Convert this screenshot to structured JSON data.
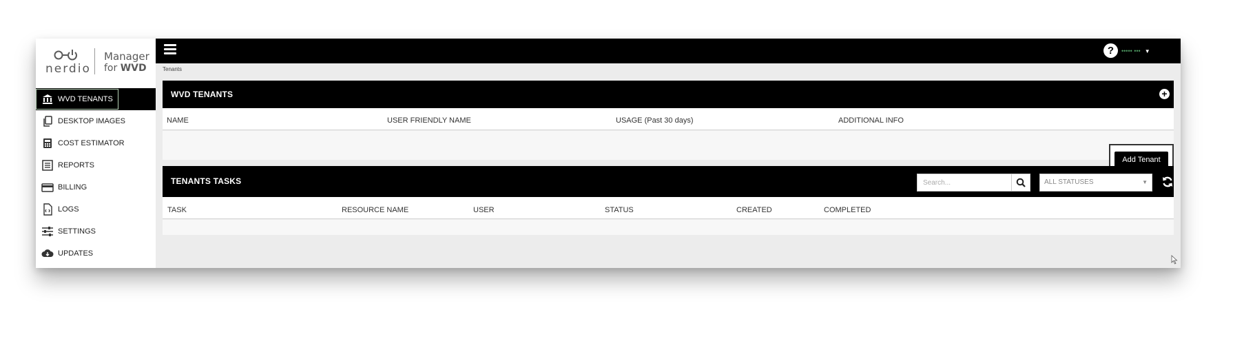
{
  "brand": {
    "wordmark": "nerdio",
    "product_line1": "Manager",
    "product_line2_prefix": "for ",
    "product_line2_bold": "WVD"
  },
  "sidebar": {
    "items": [
      {
        "label": "WVD TENANTS",
        "icon": "bank-icon",
        "active": true
      },
      {
        "label": "DESKTOP IMAGES",
        "icon": "copy-icon",
        "active": false
      },
      {
        "label": "COST ESTIMATOR",
        "icon": "calculator-icon",
        "active": false
      },
      {
        "label": "REPORTS",
        "icon": "list-icon",
        "active": false
      },
      {
        "label": "BILLING",
        "icon": "credit-card-icon",
        "active": false
      },
      {
        "label": "LOGS",
        "icon": "code-file-icon",
        "active": false
      },
      {
        "label": "SETTINGS",
        "icon": "sliders-icon",
        "active": false
      },
      {
        "label": "UPDATES",
        "icon": "cloud-download-icon",
        "active": false
      }
    ]
  },
  "topbar": {
    "help_label": "?",
    "user_name": "••••• •••"
  },
  "breadcrumb": "Tenants",
  "tenants_panel": {
    "title": "WVD TENANTS",
    "columns": [
      "NAME",
      "USER FRIENDLY NAME",
      "USAGE (Past 30 days)",
      "ADDITIONAL INFO"
    ],
    "add_button": "Add Tenant"
  },
  "tasks_panel": {
    "title": "TENANTS TASKS",
    "search_placeholder": "Search...",
    "status_filter": "ALL STATUSES",
    "columns": [
      "TASK",
      "RESOURCE NAME",
      "USER",
      "STATUS",
      "CREATED",
      "COMPLETED"
    ]
  },
  "colors": {
    "header_bg": "#000000",
    "accent_green": "#4f9a63",
    "page_bg": "#ececec"
  }
}
